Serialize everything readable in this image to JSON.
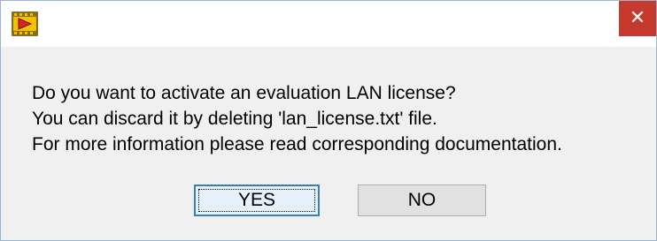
{
  "window": {
    "app_icon": "labview-arrow-icon",
    "close_icon": "close-icon",
    "close_glyph": "✕"
  },
  "message": {
    "lines": [
      "Do you want to activate an evaluation LAN license?",
      "You can discard it by deleting 'lan_license.txt' file.",
      "For more information please read corresponding documentation."
    ]
  },
  "buttons": {
    "yes_label": "YES",
    "no_label": "NO"
  },
  "colors": {
    "close_button": "#c7392d",
    "default_button_border": "#3c7fb1"
  }
}
